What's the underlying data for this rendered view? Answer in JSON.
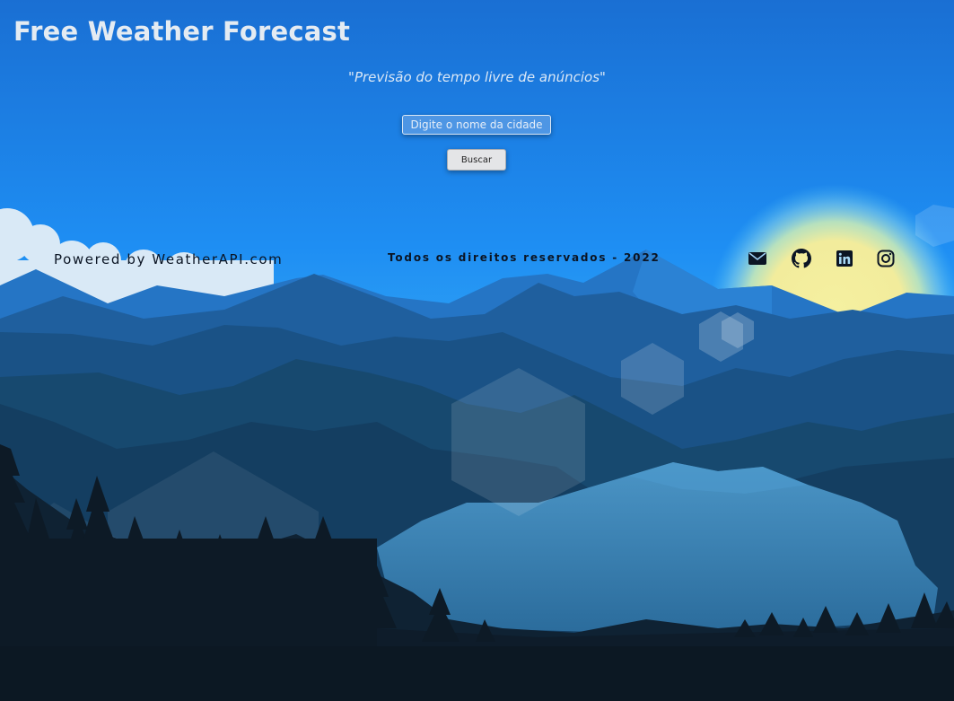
{
  "header": {
    "title": "Free Weather Forecast",
    "tagline": "\"Previsão do tempo livre de anúncios\""
  },
  "search": {
    "placeholder": "Digite o nome da cidade",
    "value": "",
    "button_label": "Buscar"
  },
  "footer": {
    "powered_by": "Powered by WeatherAPI.com",
    "copyright": "Todos os direitos reservados - 2022",
    "social_links": [
      {
        "name": "email",
        "icon": "envelope-icon"
      },
      {
        "name": "github",
        "icon": "github-icon"
      },
      {
        "name": "linkedin",
        "icon": "linkedin-icon"
      },
      {
        "name": "instagram",
        "icon": "instagram-icon"
      }
    ]
  },
  "colors": {
    "sky_top": "#1a6fd3",
    "sky_mid": "#1e8ef3",
    "sun": "#f3ee9c",
    "footer_text": "#0b1524",
    "title_text": "#e4ebf2"
  }
}
